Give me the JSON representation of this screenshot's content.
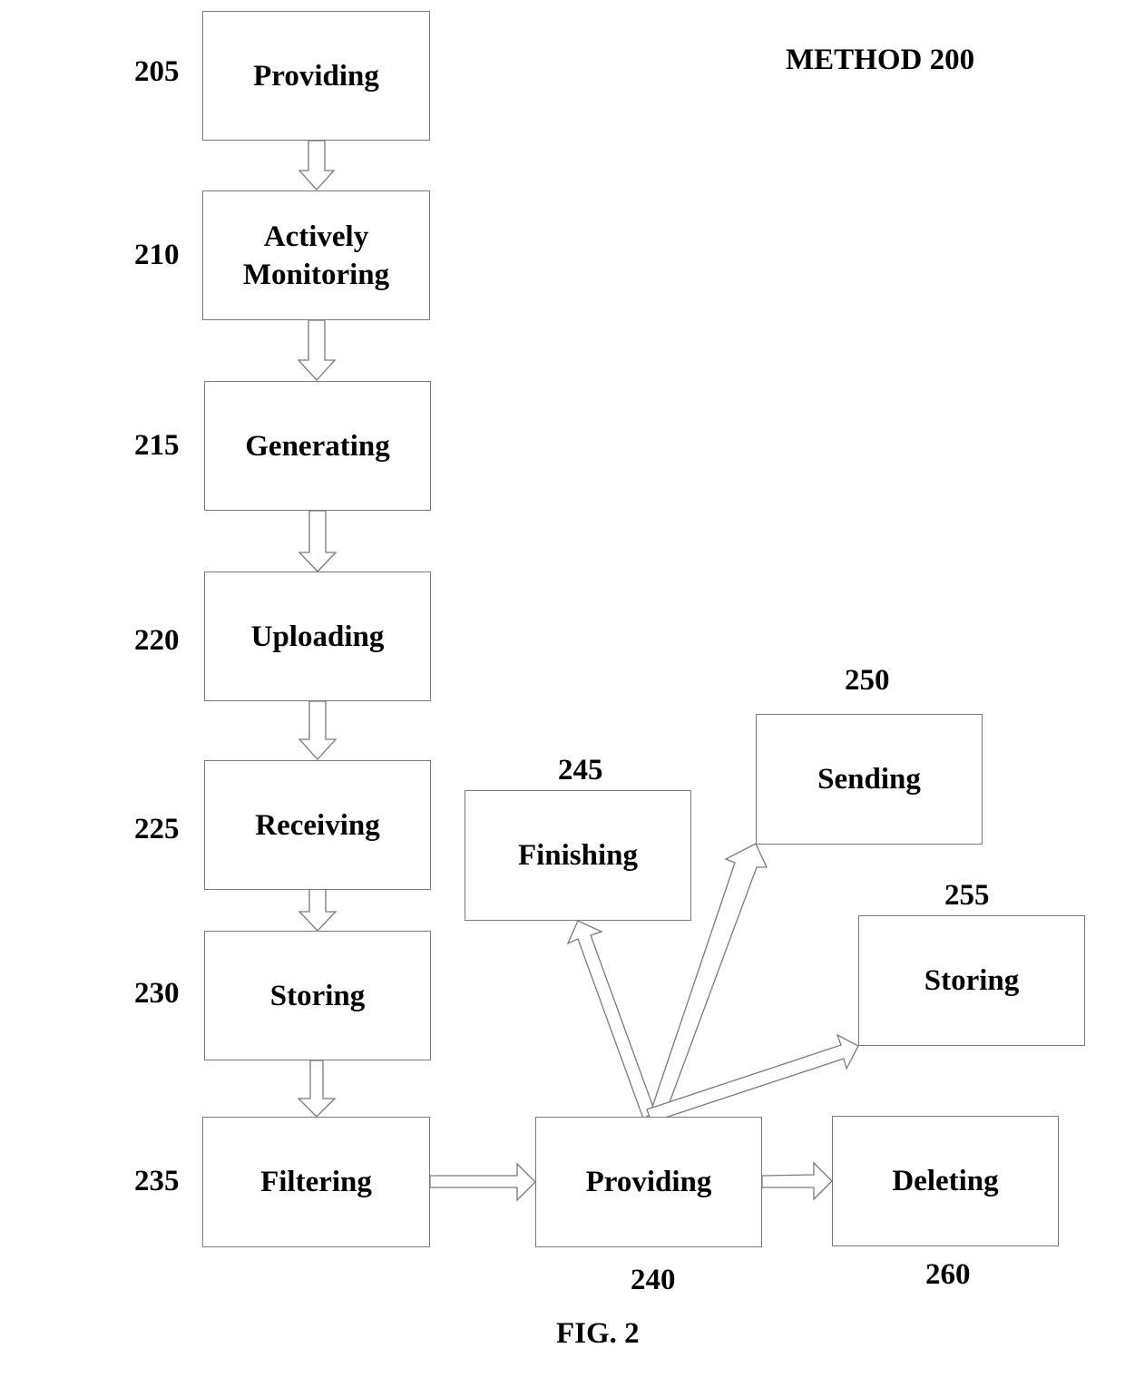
{
  "figure": {
    "method_title": "METHOD 200",
    "caption": "FIG. 2"
  },
  "steps": {
    "s205": {
      "ref": "205",
      "label": "Providing"
    },
    "s210": {
      "ref": "210",
      "label": "Actively Monitoring"
    },
    "s215": {
      "ref": "215",
      "label": "Generating"
    },
    "s220": {
      "ref": "220",
      "label": "Uploading"
    },
    "s225": {
      "ref": "225",
      "label": "Receiving"
    },
    "s230": {
      "ref": "230",
      "label": "Storing"
    },
    "s235": {
      "ref": "235",
      "label": "Filtering"
    },
    "s240": {
      "ref": "240",
      "label": "Providing"
    },
    "s245": {
      "ref": "245",
      "label": "Finishing"
    },
    "s250": {
      "ref": "250",
      "label": "Sending"
    },
    "s255": {
      "ref": "255",
      "label": "Storing"
    },
    "s260": {
      "ref": "260",
      "label": "Deleting"
    }
  },
  "flows": [
    {
      "from": "205",
      "to": "210"
    },
    {
      "from": "210",
      "to": "215"
    },
    {
      "from": "215",
      "to": "220"
    },
    {
      "from": "220",
      "to": "225"
    },
    {
      "from": "225",
      "to": "230"
    },
    {
      "from": "230",
      "to": "235"
    },
    {
      "from": "235",
      "to": "240"
    },
    {
      "from": "240",
      "to": "245"
    },
    {
      "from": "240",
      "to": "250"
    },
    {
      "from": "240",
      "to": "255"
    },
    {
      "from": "240",
      "to": "260"
    }
  ]
}
